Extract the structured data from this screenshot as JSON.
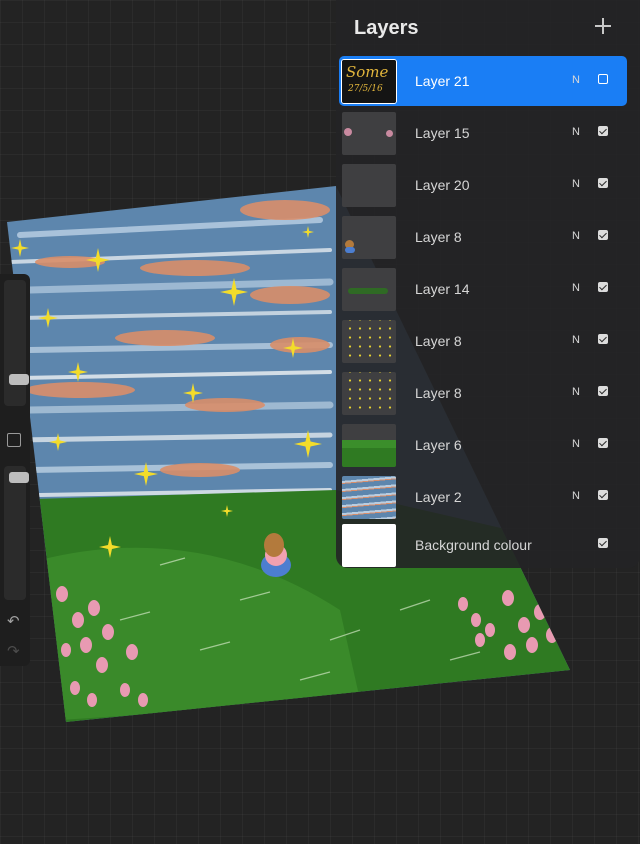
{
  "app": {
    "panel_title": "Layers"
  },
  "icons": {
    "add": "plus-icon",
    "visibility": "checkbox-icon",
    "undo": "undo-icon",
    "redo": "redo-icon"
  },
  "colors": {
    "selected_row": "#1a7ef5",
    "panel_bg": "#242426",
    "grass": "#2f7a22",
    "sky": "#5d86ad",
    "stars": "#f3dc2a",
    "tulips": "#e89ab2"
  },
  "thumbnail_signature": {
    "line1": "Some",
    "line2": "27/5/16"
  },
  "layers": [
    {
      "name": "Layer 21",
      "blend": "N",
      "visible": false,
      "selected": true,
      "thumb": "signature"
    },
    {
      "name": "Layer 15",
      "blend": "N",
      "visible": true,
      "selected": false,
      "thumb": "flowers"
    },
    {
      "name": "Layer 20",
      "blend": "N",
      "visible": true,
      "selected": false,
      "thumb": "empty"
    },
    {
      "name": "Layer 8",
      "blend": "N",
      "visible": true,
      "selected": false,
      "thumb": "girl"
    },
    {
      "name": "Layer 14",
      "blend": "N",
      "visible": true,
      "selected": false,
      "thumb": "grass-stroke"
    },
    {
      "name": "Layer 8",
      "blend": "N",
      "visible": true,
      "selected": false,
      "thumb": "stars"
    },
    {
      "name": "Layer 8",
      "blend": "N",
      "visible": true,
      "selected": false,
      "thumb": "stars"
    },
    {
      "name": "Layer 6",
      "blend": "N",
      "visible": true,
      "selected": false,
      "thumb": "hills"
    },
    {
      "name": "Layer 2",
      "blend": "N",
      "visible": true,
      "selected": false,
      "thumb": "sky"
    },
    {
      "name": "Background colour",
      "blend": "",
      "visible": true,
      "selected": false,
      "thumb": "white"
    }
  ]
}
